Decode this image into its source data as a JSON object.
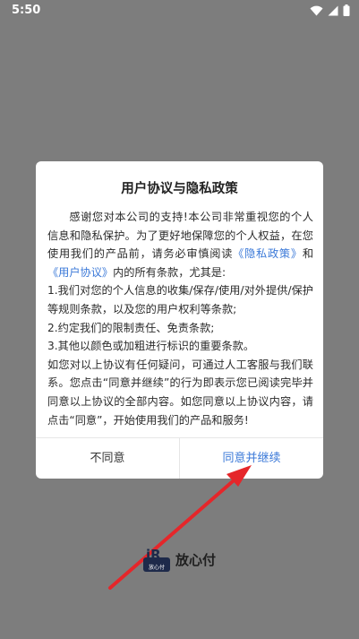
{
  "status_bar": {
    "time": "5:50",
    "wifi_icon": "wifi-icon",
    "cellular_icon": "signal-icon",
    "battery_icon": "battery-icon"
  },
  "dialog": {
    "title": "用户协议与隐私政策",
    "intro_part1": "感谢您对本公司的支持!本公司非常重视您的个人信息和隐私保护。为了更好地保障您的个人权益，在您使用我们的产品前，请务必审慎阅读",
    "privacy_link": "《隐私政策》",
    "and_text": "和",
    "user_agreement_link": "《用户协议》",
    "intro_part2": "内的所有条款，尤其是:",
    "items": [
      "1.我们对您的个人信息的收集/保存/使用/对外提供/保护等规则条款，以及您的用户权利等条款;",
      "2.约定我们的限制责任、免责条款;",
      "3.其他以颜色或加粗进行标识的重要条款。"
    ],
    "contact_text": "如您对以上协议有任何疑问，可通过人工客服与我们联系。您点击“同意并继续”的行为即表示您已阅读完毕并同意以上协议的全部内容。如您同意以上协议内容，请点击“同意”，开始使用我们的产品和服务!",
    "disagree_label": "不同意",
    "agree_label": "同意并继续"
  },
  "brand": {
    "logo_text": "放心付",
    "name": "放心付"
  },
  "colors": {
    "overlay": "#7d7d7d",
    "link": "#3b79d8",
    "arrow": "#e5262a",
    "logo_bg": "#1e2a4a"
  }
}
